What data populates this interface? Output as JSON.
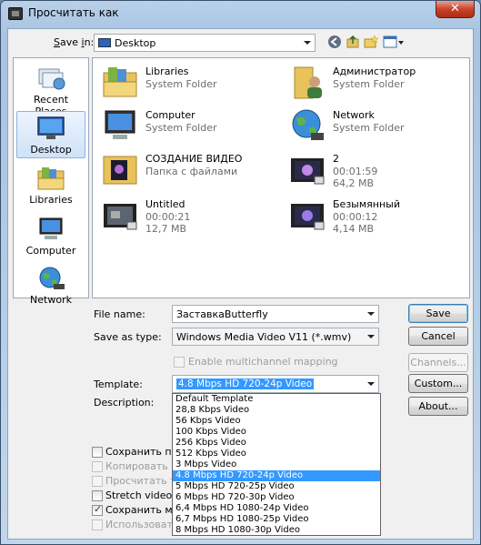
{
  "window": {
    "title": "Просчитать как",
    "close": "✕"
  },
  "savein": {
    "label": "Save in:",
    "value": "Desktop"
  },
  "places": [
    {
      "label": "Recent Places",
      "icon": "recent-places-icon"
    },
    {
      "label": "Desktop",
      "icon": "desktop-icon",
      "selected": true
    },
    {
      "label": "Libraries",
      "icon": "libraries-icon"
    },
    {
      "label": "Computer",
      "icon": "computer-icon"
    },
    {
      "label": "Network",
      "icon": "network-icon"
    }
  ],
  "files": [
    {
      "name": "Libraries",
      "line1": "System Folder",
      "line2": "",
      "icon": "libraries-icon"
    },
    {
      "name": "Администратор",
      "line1": "System Folder",
      "line2": "",
      "icon": "user-folder-icon"
    },
    {
      "name": "Computer",
      "line1": "System Folder",
      "line2": "",
      "icon": "computer-icon"
    },
    {
      "name": "Network",
      "line1": "System Folder",
      "line2": "",
      "icon": "network-icon"
    },
    {
      "name": "СОЗДАНИЕ ВИДЕО",
      "line1": "Папка с файлами",
      "line2": "",
      "icon": "folder-icon"
    },
    {
      "name": "2",
      "line1": "00:01:59",
      "line2": "64,2 MB",
      "icon": "video-file-icon"
    },
    {
      "name": "Untitled",
      "line1": "00:00:21",
      "line2": "12,7 MB",
      "icon": "video-file-icon"
    },
    {
      "name": "Безымянный",
      "line1": "00:00:12",
      "line2": "4,14 MB",
      "icon": "video-file-icon"
    }
  ],
  "form": {
    "filename_label": "File name:",
    "filename_value": "ЗаставкаButterfly",
    "savetype_label": "Save as type:",
    "savetype_value": "Windows Media Video V11 (*.wmv)",
    "multichannel_label": "Enable multichannel mapping",
    "template_label": "Template:",
    "template_value": "4.8 Mbps HD 720-24p Video",
    "description_label": "Description:"
  },
  "buttons": {
    "save": "Save",
    "cancel": "Cancel",
    "channels": "Channels...",
    "custom": "Custom...",
    "about": "About..."
  },
  "options": [
    {
      "label": "Сохранить прое",
      "checked": false,
      "disabled": false
    },
    {
      "label": "Копировать ме",
      "checked": false,
      "disabled": true
    },
    {
      "label": "Просчитать тол",
      "checked": false,
      "disabled": true
    },
    {
      "label": "Stretch video to f",
      "checked": false,
      "disabled": false
    },
    {
      "label": "Сохранить метк",
      "checked": true,
      "disabled": false
    },
    {
      "label": "Использовать у",
      "checked": false,
      "disabled": true
    }
  ],
  "template_options": [
    "Default Template",
    "28,8 Kbps Video",
    "56 Kbps Video",
    "100 Kbps Video",
    "256 Kbps Video",
    "512 Kbps Video",
    "3 Mbps Video",
    "4.8 Mbps HD 720-24p Video",
    "5 Mbps HD 720-25p Video",
    "6 Mbps HD 720-30p Video",
    "6,4 Mbps HD 1080-24p Video",
    "6,7 Mbps HD 1080-25p Video",
    "8 Mbps HD 1080-30p Video"
  ],
  "template_selected_index": 7
}
